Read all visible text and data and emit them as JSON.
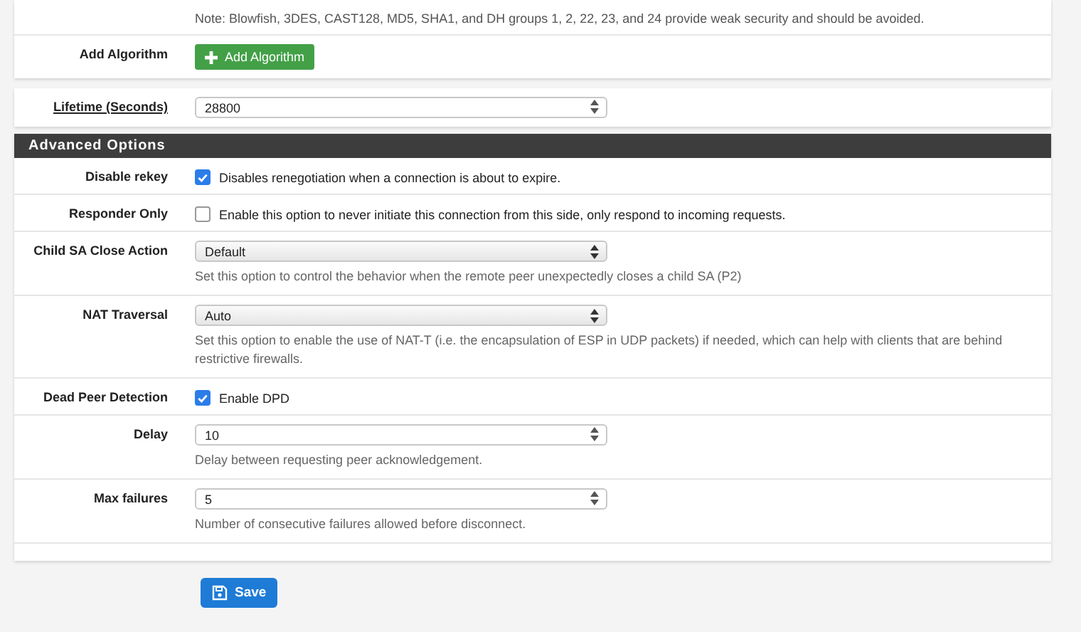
{
  "top_panel": {
    "rows": [
      {
        "kind": "note",
        "text": "Note: Blowfish, 3DES, CAST128, MD5, SHA1, and DH groups 1, 2, 22, 23, and 24 provide weak security and should be avoided."
      },
      {
        "kind": "button",
        "label": "Add Algorithm",
        "button": "Add Algorithm"
      }
    ]
  },
  "lifetime_panel": {
    "rows": [
      {
        "kind": "number",
        "label": "Lifetime (Seconds)",
        "label_link": true,
        "value": "28800"
      }
    ]
  },
  "advanced": {
    "title": "Advanced Options",
    "rows": [
      {
        "kind": "checkbox",
        "label": "Disable rekey",
        "checked": true,
        "text": "Disables renegotiation when a connection is about to expire."
      },
      {
        "kind": "checkbox",
        "label": "Responder Only",
        "checked": false,
        "text": "Enable this option to never initiate this connection from this side, only respond to incoming requests."
      },
      {
        "kind": "select",
        "label": "Child SA Close Action",
        "value": "Default",
        "help": "Set this option to control the behavior when the remote peer unexpectedly closes a child SA (P2)"
      },
      {
        "kind": "select",
        "label": "NAT Traversal",
        "value": "Auto",
        "help": "Set this option to enable the use of NAT-T (i.e. the encapsulation of ESP in UDP packets) if needed, which can help with clients that are behind restrictive firewalls."
      },
      {
        "kind": "checkbox",
        "label": "Dead Peer Detection",
        "checked": true,
        "text": "Enable DPD"
      },
      {
        "kind": "number",
        "label": "Delay",
        "value": "10",
        "help": "Delay between requesting peer acknowledgement."
      },
      {
        "kind": "number",
        "label": "Max failures",
        "value": "5",
        "help": "Number of consecutive failures allowed before disconnect."
      }
    ]
  },
  "save_button": "Save"
}
